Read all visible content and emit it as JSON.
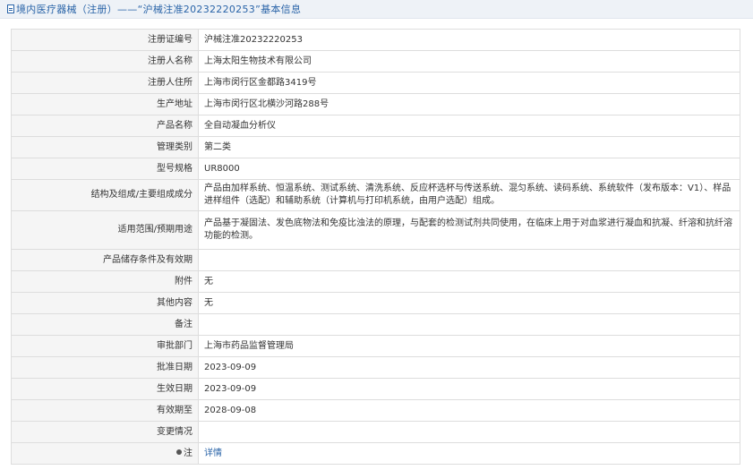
{
  "header": {
    "title": "境内医疗器械（注册）——“沪械注准20232220253”基本信息"
  },
  "rows": [
    {
      "label": "注册证编号",
      "value": "沪械注准20232220253"
    },
    {
      "label": "注册人名称",
      "value": "上海太阳生物技术有限公司"
    },
    {
      "label": "注册人住所",
      "value": "上海市闵行区金都路3419号"
    },
    {
      "label": "生产地址",
      "value": "上海市闵行区北横沙河路288号"
    },
    {
      "label": "产品名称",
      "value": "全自动凝血分析仪"
    },
    {
      "label": "管理类别",
      "value": "第二类"
    },
    {
      "label": "型号规格",
      "value": "UR8000"
    },
    {
      "label": "结构及组成/主要组成成分",
      "value": "产品由加样系统、恒温系统、测试系统、清洗系统、反应杯选杯与传送系统、混匀系统、读码系统、系统软件（发布版本：V1）、样品进样组件（选配）和辅助系统（计算机与打印机系统，由用户选配）组成。"
    },
    {
      "label": "适用范围/预期用途",
      "value": "产品基于凝固法、发色底物法和免疫比浊法的原理，与配套的检测试剂共同使用，在临床上用于对血浆进行凝血和抗凝、纤溶和抗纤溶功能的检测。"
    },
    {
      "label": "产品储存条件及有效期",
      "value": ""
    },
    {
      "label": "附件",
      "value": "无"
    },
    {
      "label": "其他内容",
      "value": "无"
    },
    {
      "label": "备注",
      "value": ""
    },
    {
      "label": "审批部门",
      "value": "上海市药品监督管理局"
    },
    {
      "label": "批准日期",
      "value": "2023-09-09"
    },
    {
      "label": "生效日期",
      "value": "2023-09-09"
    },
    {
      "label": "有效期至",
      "value": "2028-09-08"
    },
    {
      "label": "变更情况",
      "value": ""
    },
    {
      "label": "注",
      "value": "详情"
    }
  ]
}
